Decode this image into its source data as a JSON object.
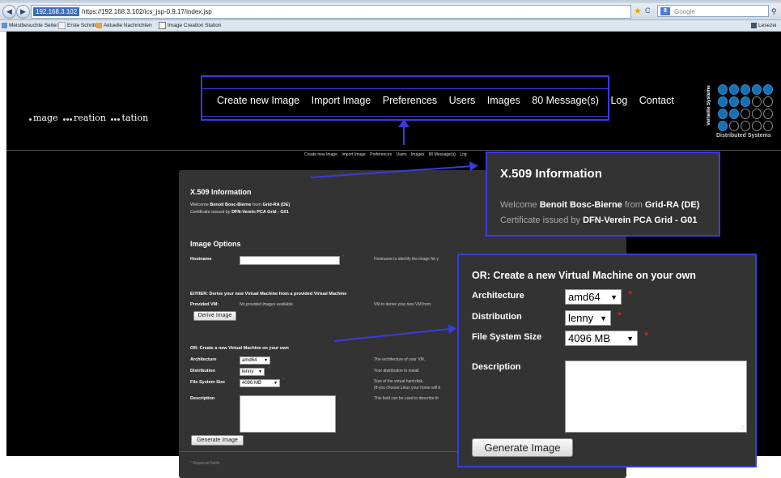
{
  "browser": {
    "url_host": "192.168.3.102",
    "url": "https://192.168.3.102/ics_jsp-0.9.17/index.jsp",
    "search_provider": "Google",
    "bookmarks": [
      "Meistbesuchte Seiten",
      "Erste Schritte",
      "Aktuelle Nachrichten",
      "Image Creation Station"
    ],
    "reading_list": "Lesezei"
  },
  "logo": {
    "part1": "mage",
    "part2": "reation",
    "part3": "tation"
  },
  "brand": {
    "vertical_text": "Verteilte Systeme",
    "subtitle": "Distributed Systems"
  },
  "nav": {
    "items": [
      "Create new Image",
      "Import Image",
      "Preferences",
      "Users",
      "Images",
      "80 Message(s)",
      "Log",
      "Contact"
    ]
  },
  "small_nav": {
    "items": [
      "Create new Image",
      "Import Image",
      "Preferences",
      "Users",
      "Images",
      "80 Message(s)",
      "Log"
    ]
  },
  "x509": {
    "heading": "X.509 Information",
    "welcome_prefix": "Welcome",
    "user": "Benoit Bosc-Bierne",
    "from_word": "from",
    "org": "Grid-RA (DE)",
    "cert_prefix": "Certificate issued by",
    "issuer": "DFN-Verein PCA Grid - G01"
  },
  "image_options": {
    "heading": "Image Options",
    "hostname_label": "Hostname",
    "hostname_hint": "Hostname to identify the image for y"
  },
  "either": {
    "heading": "EITHER: Derive your new Virtual Machine from a provided Virtual Machine",
    "provided_label": "Provided VM:",
    "provided_value": "No provided images available.",
    "provided_hint": "VM to derive your new VM from.",
    "derive_button": "Derive Image"
  },
  "or_section": {
    "heading": "OR: Create a new Virtual Machine on your own",
    "architecture_label": "Architecture",
    "architecture_value": "amd64",
    "architecture_hint": "The architecture of your VM.",
    "distribution_label": "Distribution",
    "distribution_value": "lenny",
    "distribution_hint": "Your distribution to install.",
    "fs_label": "File System Size",
    "fs_value": "4096 MB",
    "fs_hint1": "Size of the virtual hard disk.",
    "fs_hint2": "(If you choose Linux your home will b",
    "description_label": "Description",
    "description_hint": "This field can be used to describe th",
    "generate_button": "Generate Image",
    "required_note": "Required fields",
    "required_mark": "*"
  },
  "colors": {
    "callout_border": "#3b3be0",
    "panel_bg": "#333333",
    "required": "#e02020"
  }
}
